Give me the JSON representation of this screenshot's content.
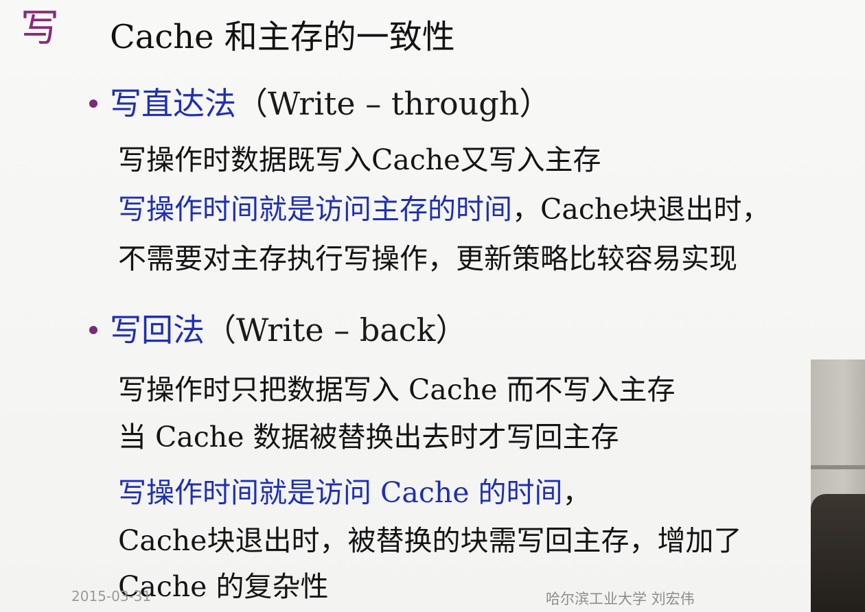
{
  "slide": {
    "title_mark": "写",
    "title": "Cache 和主存的一致性",
    "sections": [
      {
        "bullet": {
          "term": "写直达法",
          "paren": "（Write – through）"
        },
        "lines": [
          {
            "black": "写操作时数据既写入Cache又写入主存"
          },
          {
            "blue": "写操作时间就是访问主存的时间",
            "black": "，Cache块退出时，"
          },
          {
            "black": "不需要对主存执行写操作，更新策略比较容易实现"
          }
        ]
      },
      {
        "bullet": {
          "term": "写回法",
          "paren": "（Write – back）"
        },
        "lines": [
          {
            "black": "写操作时只把数据写入 Cache 而不写入主存"
          },
          {
            "black": "当 Cache 数据被替换出去时才写回主存"
          },
          {
            "blue": "写操作时间就是访问 Cache 的时间",
            "black": "，"
          },
          {
            "black": "Cache块退出时，被替换的块需写回主存，增加了"
          },
          {
            "black": "Cache 的复杂性"
          }
        ]
      }
    ],
    "footer": {
      "date": "2015-03-31",
      "author": "哈尔滨工业大学  刘宏伟"
    }
  },
  "colors": {
    "title_mark": "#8a2a7a",
    "bullet_dot": "#7a2a78",
    "emphasis_blue": "#1e2fb6",
    "body_text": "#141414",
    "footer_text": "#9a9a9a"
  }
}
